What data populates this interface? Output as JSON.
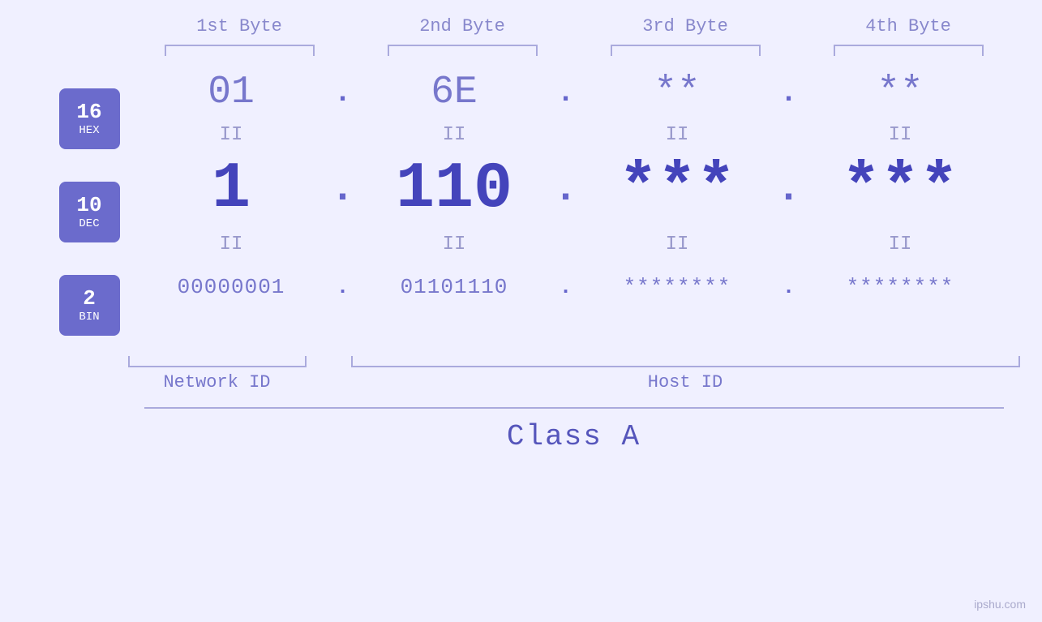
{
  "byteHeaders": {
    "b1": "1st Byte",
    "b2": "2nd Byte",
    "b3": "3rd Byte",
    "b4": "4th Byte"
  },
  "badges": {
    "hex": {
      "num": "16",
      "label": "HEX"
    },
    "dec": {
      "num": "10",
      "label": "DEC"
    },
    "bin": {
      "num": "2",
      "label": "BIN"
    }
  },
  "hexValues": {
    "b1": "01",
    "b2": "6E",
    "b3": "**",
    "b4": "**"
  },
  "decValues": {
    "b1": "1",
    "b2": "110",
    "b3": "***",
    "b4": "***"
  },
  "binValues": {
    "b1": "00000001",
    "b2": "01101110",
    "b3": "********",
    "b4": "********"
  },
  "dots": ".",
  "equalSign": "II",
  "labels": {
    "networkId": "Network ID",
    "hostId": "Host ID",
    "classA": "Class A"
  },
  "watermark": "ipshu.com"
}
